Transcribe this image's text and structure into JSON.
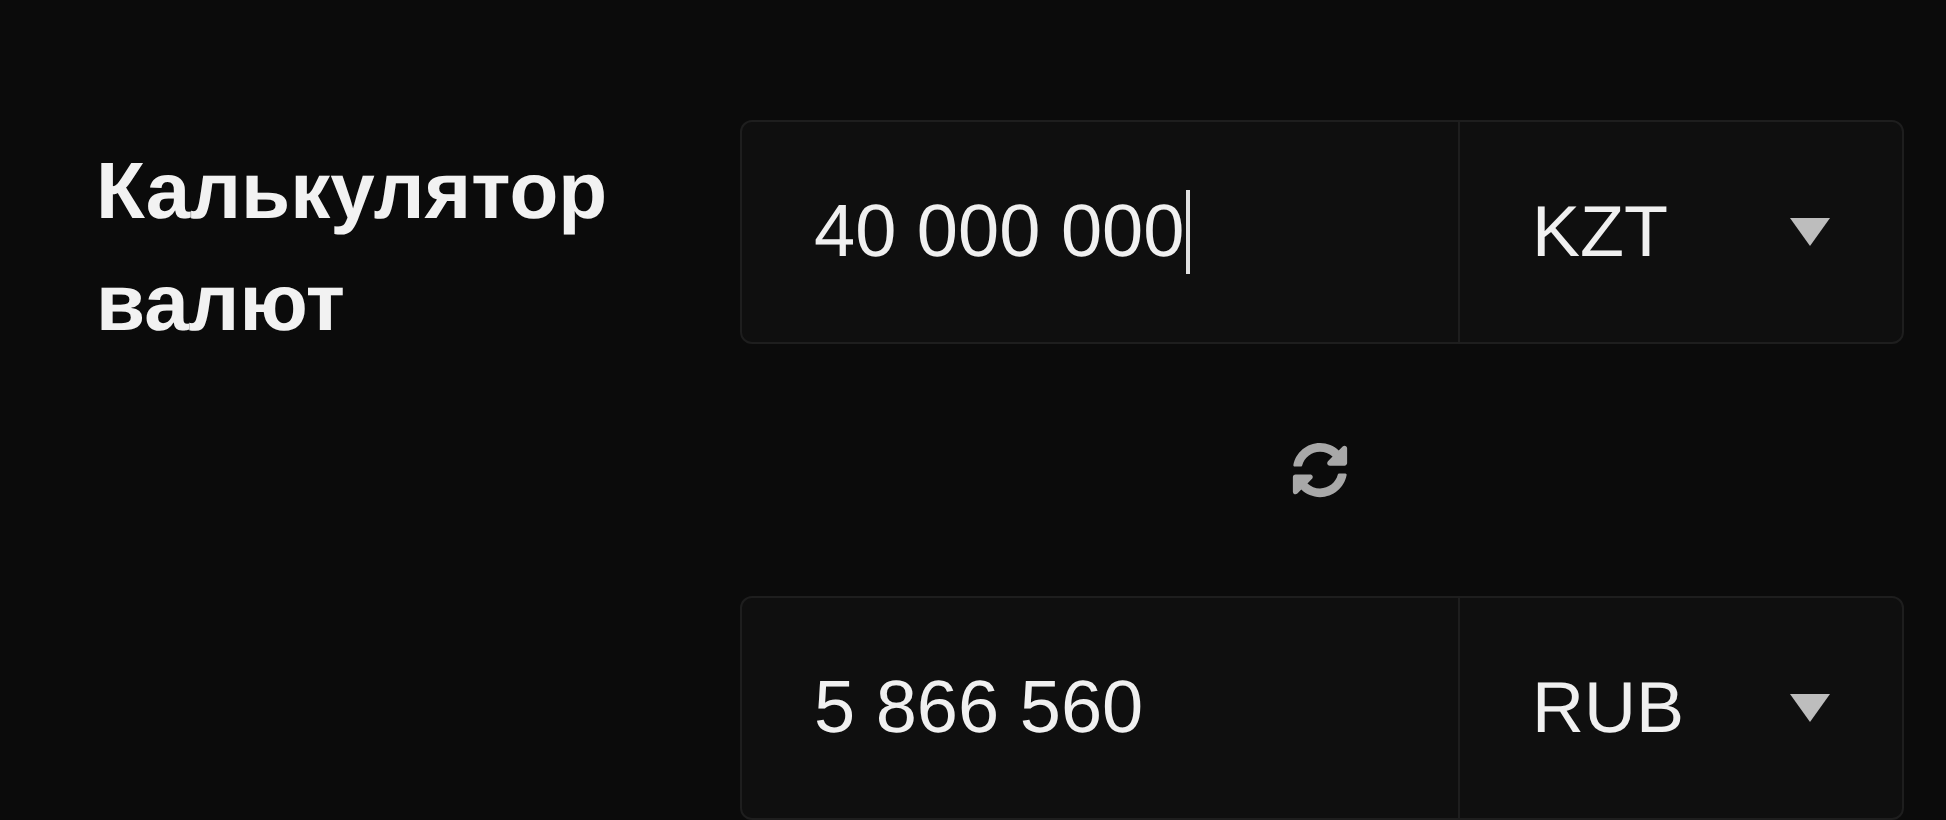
{
  "title": "Калькулятор валют",
  "rows": [
    {
      "value": "40 000 000",
      "currency": "KZT",
      "focused": true
    },
    {
      "value": "5 866 560",
      "currency": "RUB",
      "focused": false
    }
  ]
}
